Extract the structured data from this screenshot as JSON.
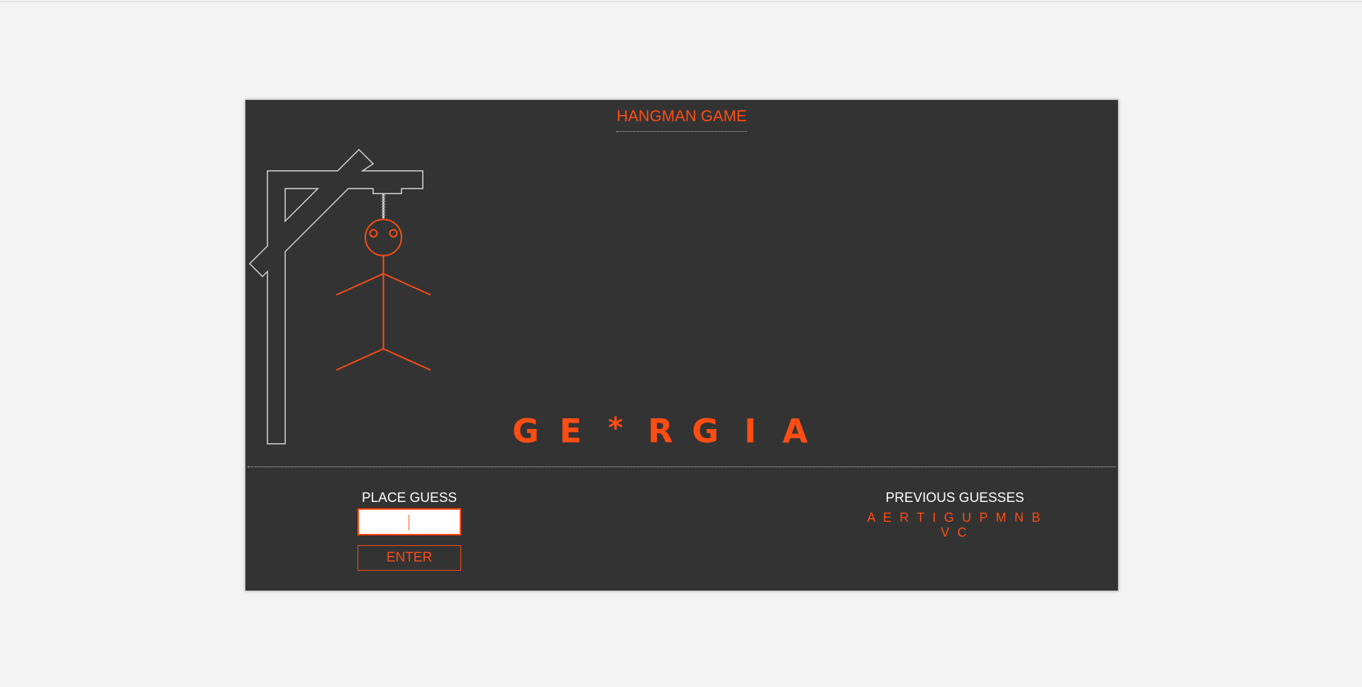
{
  "game": {
    "title": "HANGMAN GAME",
    "word_display": [
      "G",
      "E",
      "*",
      "R",
      "G",
      "I",
      "A"
    ],
    "guess_input": {
      "label": "PLACE GUESS",
      "value": ""
    },
    "enter_label": "ENTER",
    "previous_guesses": {
      "label": "PREVIOUS GUESSES",
      "letters": "A E R T I G U P M N B V C"
    },
    "hangman_parts_shown": [
      "head",
      "eyes",
      "body",
      "left-arm",
      "right-arm",
      "left-leg",
      "right-leg"
    ]
  },
  "colors": {
    "accent": "#ff4d14",
    "panel": "#333333",
    "page": "#f3f3f3",
    "gallows_stroke": "#d9d9d9"
  }
}
